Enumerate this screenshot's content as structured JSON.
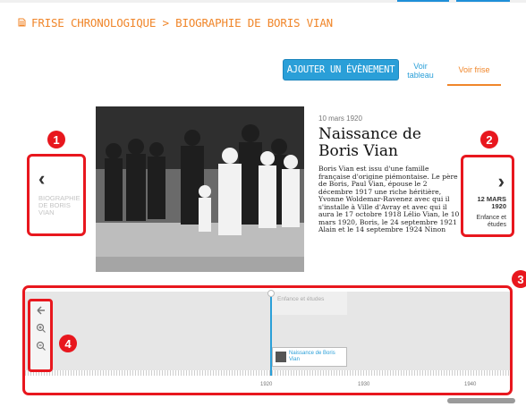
{
  "header": {
    "title": "FRISE CHRONOLOGIQUE > BIOGRAPHIE DE BORIS VIAN",
    "icon": "document-icon"
  },
  "toolbar": {
    "add_event_label": "AJOUTER UN ÉVÈNEMENT",
    "view_table_label": "Voir tableau",
    "view_frise_label": "Voir frise"
  },
  "nav_prev": {
    "label": "BIOGRAPHIE DE BORIS VIAN"
  },
  "nav_next": {
    "date": "12 MARS 1920",
    "category": "Enfance et études"
  },
  "event": {
    "date": "10 mars 1920",
    "title": "Naissance de Boris Vian",
    "body": "Boris Vian est issu d'une famille française d'origine piémontaise. Le père de Boris, Paul Vian, épouse le 2 décembre 1917 une riche héritière, Yvonne Woldemar-Ravenez avec qui il s'installe à Ville d'Avray et avec qui il aura le 17 octobre 1918 Lélio Vian, le 10 mars 1920, Boris, le 24 septembre 1921 Alain et le 14 septembre 1924 Ninon"
  },
  "timeline": {
    "period_label": "Enfance et études",
    "marker_label": "Naissance de Boris Vian",
    "years": [
      "1920",
      "1930",
      "1940"
    ]
  },
  "badges": [
    "1",
    "2",
    "3",
    "4"
  ],
  "colors": {
    "accent_orange": "#f0862a",
    "accent_blue": "#2a9fd8",
    "annotation_red": "#e8171e"
  }
}
